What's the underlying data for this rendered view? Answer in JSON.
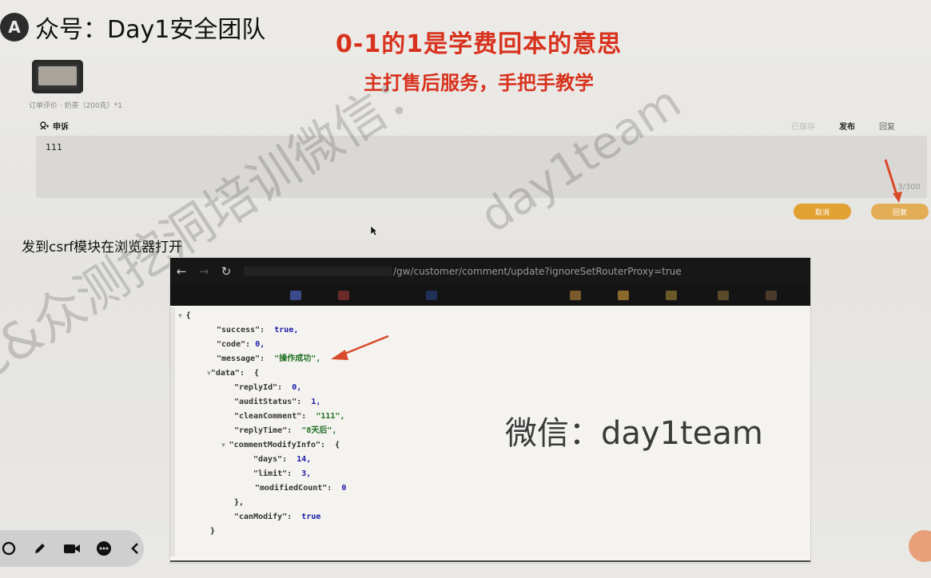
{
  "header": {
    "logo_letter": "A",
    "account_label": "众号：Day1安全团队"
  },
  "promo": {
    "line1": "0-1的1是学费回本的意思",
    "line2": "主打售后服务，手把手教学"
  },
  "form": {
    "order_info": "订单评价 · 奶茶（200克）*1",
    "reply_label": "申诉",
    "reply_text": "111",
    "counter": "3/300",
    "draft_label": "已保存",
    "publish_label": "发布",
    "reply_tab_label": "回复",
    "cancel_button": "取消",
    "reply_button": "回复"
  },
  "instruction": "发到csrf模块在浏览器打开",
  "browser": {
    "url_path": "/gw/customer/comment/update?ignoreSetRouterProxy=true",
    "bookmark_colors": [
      "#3a4a8a",
      "#6a2a2a",
      "#1f2f55",
      "#7a5a2a",
      "#8a6a2a",
      "#6a5a2a",
      "#5a4a2a",
      "#4a3a2a"
    ]
  },
  "json": {
    "open_brace": "{",
    "close_brace": "}",
    "success_key": "\"success\":",
    "success_val": "true,",
    "code_key": "\"code\":",
    "code_val": "0,",
    "message_key": "\"message\":",
    "message_val": "\"操作成功\",",
    "data_key": "\"data\":",
    "data_open": "{",
    "replyId_key": "\"replyId\":",
    "replyId_val": "0,",
    "auditStatus_key": "\"auditStatus\":",
    "auditStatus_val": "1,",
    "cleanComment_key": "\"cleanComment\":",
    "cleanComment_val": "\"111\",",
    "replyTime_key": "\"replyTime\":",
    "replyTime_val": "\"8天后\",",
    "cmi_key": "\"commentModifyInfo\":",
    "cmi_open": "{",
    "days_key": "\"days\":",
    "days_val": "14,",
    "limit_key": "\"limit\":",
    "limit_val": "3,",
    "modifiedCount_key": "\"modifiedCount\":",
    "modifiedCount_val": "0",
    "cmi_close": "},",
    "canModify_key": "\"canModify\":",
    "canModify_val": "true",
    "data_close": "}"
  },
  "wechat_note": "微信：day1team",
  "watermarks": {
    "left": "C&众测挖洞培训微信：",
    "right": "day1team"
  },
  "colors": {
    "promo_red": "#d8321e",
    "button_orange": "#e2a133",
    "arrow_red": "#d84a2a"
  }
}
